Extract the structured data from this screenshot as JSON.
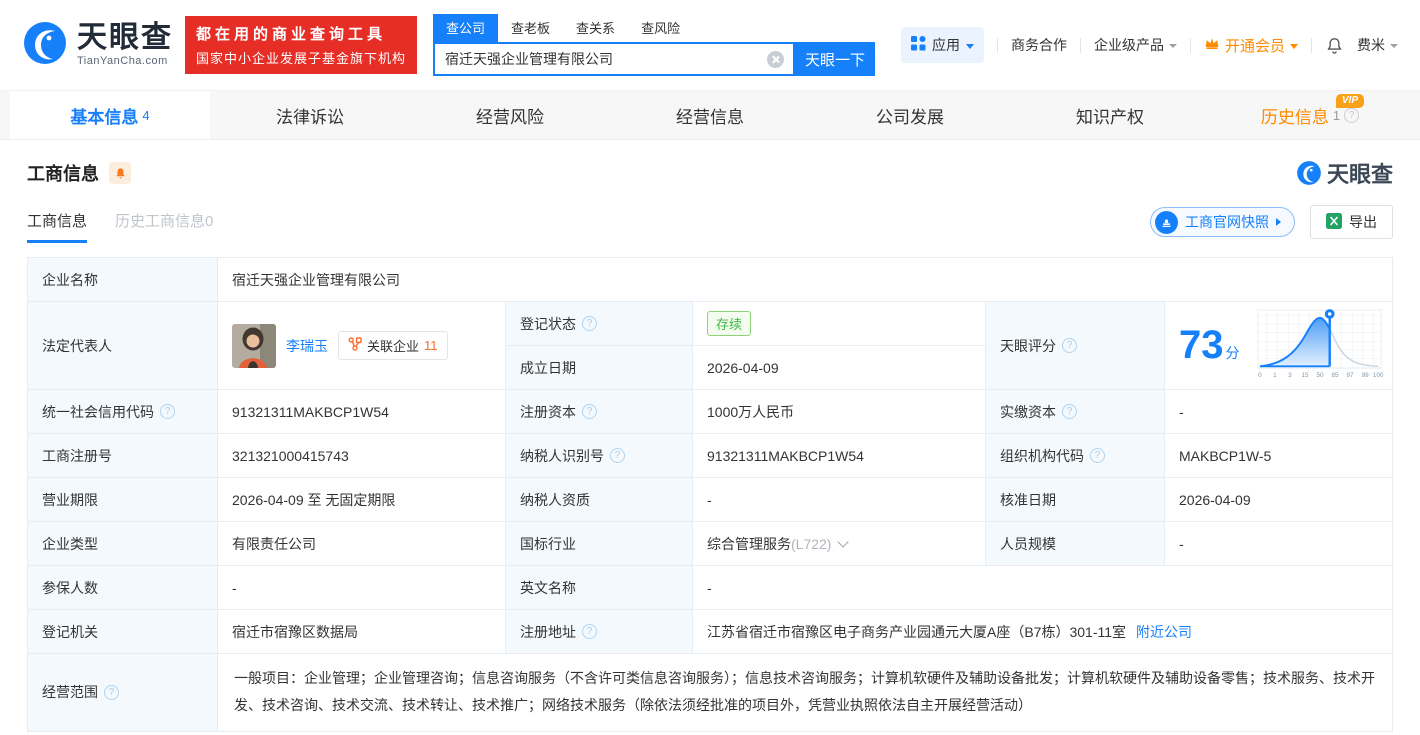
{
  "brand": {
    "cn": "天眼查",
    "en": "TianYanCha.com",
    "slogan1": "都在用的商业查询工具",
    "slogan2": "国家中小企业发展子基金旗下机构"
  },
  "search": {
    "tabs": [
      "查公司",
      "查老板",
      "查关系",
      "查风险"
    ],
    "value": "宿迁天强企业管理有限公司",
    "button": "天眼一下"
  },
  "menu": {
    "apps": "应用",
    "coop": "商务合作",
    "enterprise": "企业级产品",
    "vip": "开通会员",
    "user": "费米"
  },
  "nav": {
    "tabs": [
      {
        "label": "基本信息",
        "count": "4"
      },
      {
        "label": "法律诉讼"
      },
      {
        "label": "经营风险"
      },
      {
        "label": "经营信息"
      },
      {
        "label": "公司发展"
      },
      {
        "label": "知识产权"
      },
      {
        "label": "历史信息",
        "count": "1"
      }
    ],
    "vip_badge": "VIP"
  },
  "section": {
    "title": "工商信息",
    "subtabs": [
      {
        "label": "工商信息"
      },
      {
        "label": "历史工商信息0"
      }
    ],
    "snapshot": "工商官网快照",
    "export": "导出",
    "watermark": "天眼查"
  },
  "icons": {
    "q": "?"
  },
  "info": {
    "name_label": "企业名称",
    "name": "宿迁天强企业管理有限公司",
    "legal_rep_label": "法定代表人",
    "legal_rep": "李瑞玉",
    "related_label": "关联企业",
    "related_count": "11",
    "reg_status_label": "登记状态",
    "reg_status": "存续",
    "est_date_label": "成立日期",
    "est_date": "2026-04-09",
    "score_label": "天眼评分",
    "score_value": "73",
    "score_unit": "分",
    "credit_code_label": "统一社会信用代码",
    "credit_code": "91321311MAKBCP1W54",
    "reg_capital_label": "注册资本",
    "reg_capital": "1000万人民币",
    "paid_capital_label": "实缴资本",
    "paid_capital": "-",
    "reg_number_label": "工商注册号",
    "reg_number": "321321000415743",
    "taxpayer_id_label": "纳税人识别号",
    "taxpayer_id": "91321311MAKBCP1W54",
    "org_code_label": "组织机构代码",
    "org_code": "MAKBCP1W-5",
    "business_term_label": "营业期限",
    "business_term": "2026-04-09 至 无固定期限",
    "taxpayer_quality_label": "纳税人资质",
    "taxpayer_quality": "-",
    "approval_date_label": "核准日期",
    "approval_date": "2026-04-09",
    "company_type_label": "企业类型",
    "company_type": "有限责任公司",
    "industry_label": "国标行业",
    "industry": "综合管理服务",
    "industry_code": "(L722)",
    "staff_size_label": "人员规模",
    "staff_size": "-",
    "insured_label": "参保人数",
    "insured": "-",
    "english_name_label": "英文名称",
    "english_name": "-",
    "reg_authority_label": "登记机关",
    "reg_authority": "宿迁市宿豫区数据局",
    "address_label": "注册地址",
    "address": "江苏省宿迁市宿豫区电子商务产业园通元大厦A座（B7栋）301-11室",
    "nearby_link": "附近公司",
    "scope_label": "经营范围",
    "scope": "一般项目：企业管理；企业管理咨询；信息咨询服务（不含许可类信息咨询服务）；信息技术咨询服务；计算机软硬件及辅助设备批发；计算机软硬件及辅助设备零售；技术服务、技术开发、技术咨询、技术交流、技术转让、技术推广；网络技术服务（除依法须经批准的项目外，凭营业执照依法自主开展经营活动）"
  },
  "score_chart": {
    "type": "area",
    "ticks": [
      "0",
      "1",
      "3",
      "15",
      "50",
      "85",
      "97",
      "99",
      "100"
    ],
    "marker_value": 73,
    "accent_color": "#1680fb"
  }
}
